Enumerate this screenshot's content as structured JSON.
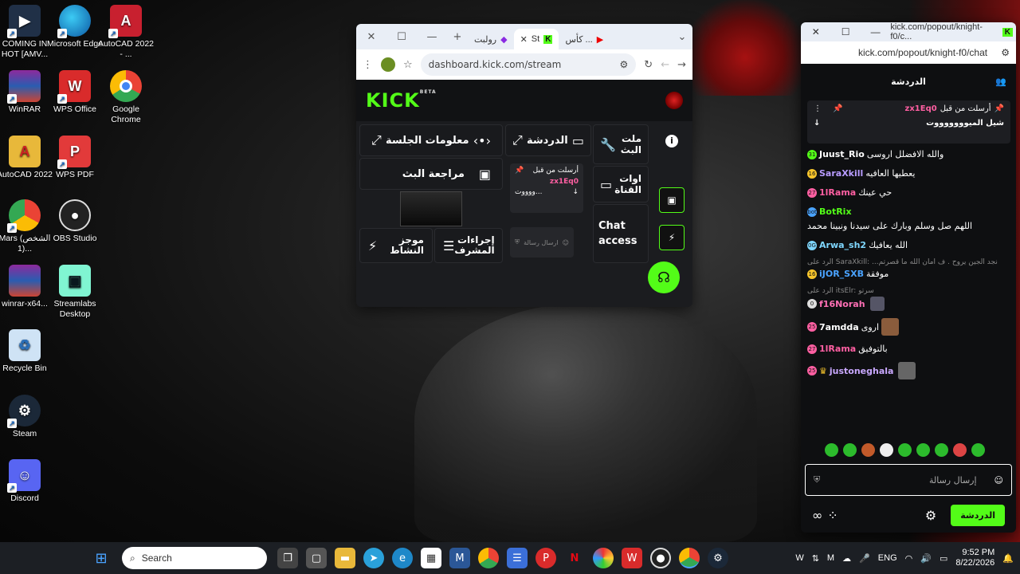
{
  "desktop": {
    "icons": [
      {
        "label": "COMING IN HOT [AMV..."
      },
      {
        "label": "Microsoft Edge"
      },
      {
        "label": "AutoCAD 2022 - ..."
      },
      {
        "label": "WinRAR"
      },
      {
        "label": "WPS Office"
      },
      {
        "label": "Google Chrome"
      },
      {
        "label": "AutoCAD 2022"
      },
      {
        "label": "WPS PDF"
      },
      {
        "label": "Mars (الشخص 1)..."
      },
      {
        "label": "OBS Studio"
      },
      {
        "label": "winrar-x64..."
      },
      {
        "label": "Streamlabs Desktop"
      },
      {
        "label": "Recycle Bin"
      },
      {
        "label": "Steam"
      },
      {
        "label": "Discord"
      }
    ]
  },
  "browser": {
    "tabs": [
      {
        "label": "كأس ..."
      },
      {
        "label": "St"
      },
      {
        "label": "رولبت"
      }
    ],
    "url": "dashboard.kick.com/stream",
    "logo": "KICK",
    "logo_badge": "BETA",
    "panels": {
      "session_info": "معلومات الجلسة",
      "chat": "الدردشة",
      "stream_tools": "ملت البث",
      "stream_review": "مراجعة البث",
      "channel_info": "اوات القناة",
      "pinned_sent_by": "أرسلت من قبل",
      "pinned_user": "zx1Eq0",
      "pinned_text": "...ووووت",
      "chat_access": "Chat access",
      "mod_actions": "إجراءات المشرف",
      "activity_feed": "موجز النشاط",
      "send_message": "ارسال رسالة"
    }
  },
  "popout": {
    "title_url": "kick.com/popout/knight-f0/c...",
    "url": "kick.com/popout/knight-f0/chat",
    "header": "الدردشة",
    "pinned": {
      "sent_by": "أرسلت من قبل",
      "user": "zx1Eq0",
      "text": "شيل الميوووووووت"
    },
    "messages": [
      {
        "user": "Juust_Rio",
        "text": "والله الافضلل اروسى",
        "color": "#ffffff",
        "badge": "31"
      },
      {
        "user": "SaraXkill",
        "text": "يعطيها العافيه",
        "color": "#b89cff",
        "badge": "16"
      },
      {
        "user": "1lRama",
        "text": "حي عينك",
        "color": "#ff5fa2",
        "badge": "27"
      },
      {
        "user": "BotRix",
        "text": "اللهم صل وسلم وبارك على سيدنا ونبينا محمد",
        "color": "#53fc18",
        "badge": "bot"
      },
      {
        "user": "Arwa_sh2",
        "text": "الله يعافيك",
        "color": "#7fd7ff",
        "badge": "0G"
      },
      {
        "reply": "الرد على SaraXkill: ...نجد الجين يروح . ف امان الله ما قصرتم",
        "user": "iJOR_SXB",
        "text": "موفقة",
        "color": "#4aa3ff",
        "badge": "16"
      },
      {
        "reply": "الرد على itsElr: سرتو",
        "user": "f16Norah",
        "text": "",
        "color": "#ff6fb5",
        "badge": "0"
      },
      {
        "user": "7amdda",
        "text": "اروى",
        "color": "#ffffff",
        "badge": "25"
      },
      {
        "user": "1lRama",
        "text": "بالتوفيق",
        "color": "#ff5fa2",
        "badge": "27"
      },
      {
        "user": "justoneghala",
        "text": "",
        "color": "#c9a8ff",
        "badge": "25"
      }
    ],
    "input_placeholder": "إرسال رسالة",
    "chat_button": "الدردشة"
  },
  "taskbar": {
    "search_placeholder": "Search",
    "lang": "ENG",
    "time": "9:52 PM",
    "date": "8/22/2026"
  },
  "colors": {
    "kick_green": "#53fc18",
    "taskbar_bg": "#1c1f24"
  }
}
